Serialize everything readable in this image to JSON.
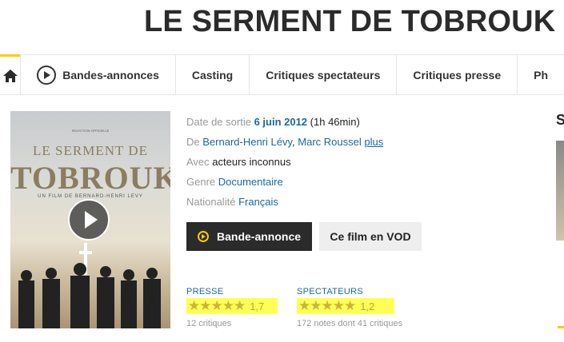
{
  "title": "LE SERMENT DE TOBROUK",
  "nav": {
    "home_icon": "home-icon",
    "items": [
      {
        "label": "Bandes-annonces",
        "icon": "play-circle-icon"
      },
      {
        "label": "Casting"
      },
      {
        "label": "Critiques spectateurs"
      },
      {
        "label": "Critiques presse"
      },
      {
        "label": "Ph"
      }
    ]
  },
  "poster": {
    "line1": "LE SERMENT DE",
    "line2": "TOBROUK",
    "line3": "UN FILM DE BERNARD-HENRI LEVY",
    "selection": "SELECTION OFFICIELLE"
  },
  "info": {
    "release_label": "Date de sortie",
    "release_date": "6 juin 2012",
    "duration": "(1h 46min)",
    "by_label": "De",
    "director1": "Bernard-Henri Lévy",
    "director2": "Marc Roussel",
    "more": "plus",
    "with_label": "Avec",
    "cast": "acteurs inconnus",
    "genre_label": "Genre",
    "genre": "Documentaire",
    "nationality_label": "Nationalité",
    "nationality": "Français"
  },
  "buttons": {
    "trailer": "Bande-annonce",
    "vod": "Ce film en VOD"
  },
  "ratings": {
    "press": {
      "label": "PRESSE",
      "stars": "★★★★★",
      "score": "1,7",
      "count": "12 critiques"
    },
    "spectators": {
      "label": "SPECTATEURS",
      "stars": "★★★★★",
      "score": "1,2",
      "count": "172 notes dont 41 critiques"
    }
  },
  "right_heading": "S",
  "colors": {
    "accent": "#fecc00",
    "link": "#1a6aa1",
    "dark": "#2b2b2b",
    "highlight": "#ffff55"
  }
}
